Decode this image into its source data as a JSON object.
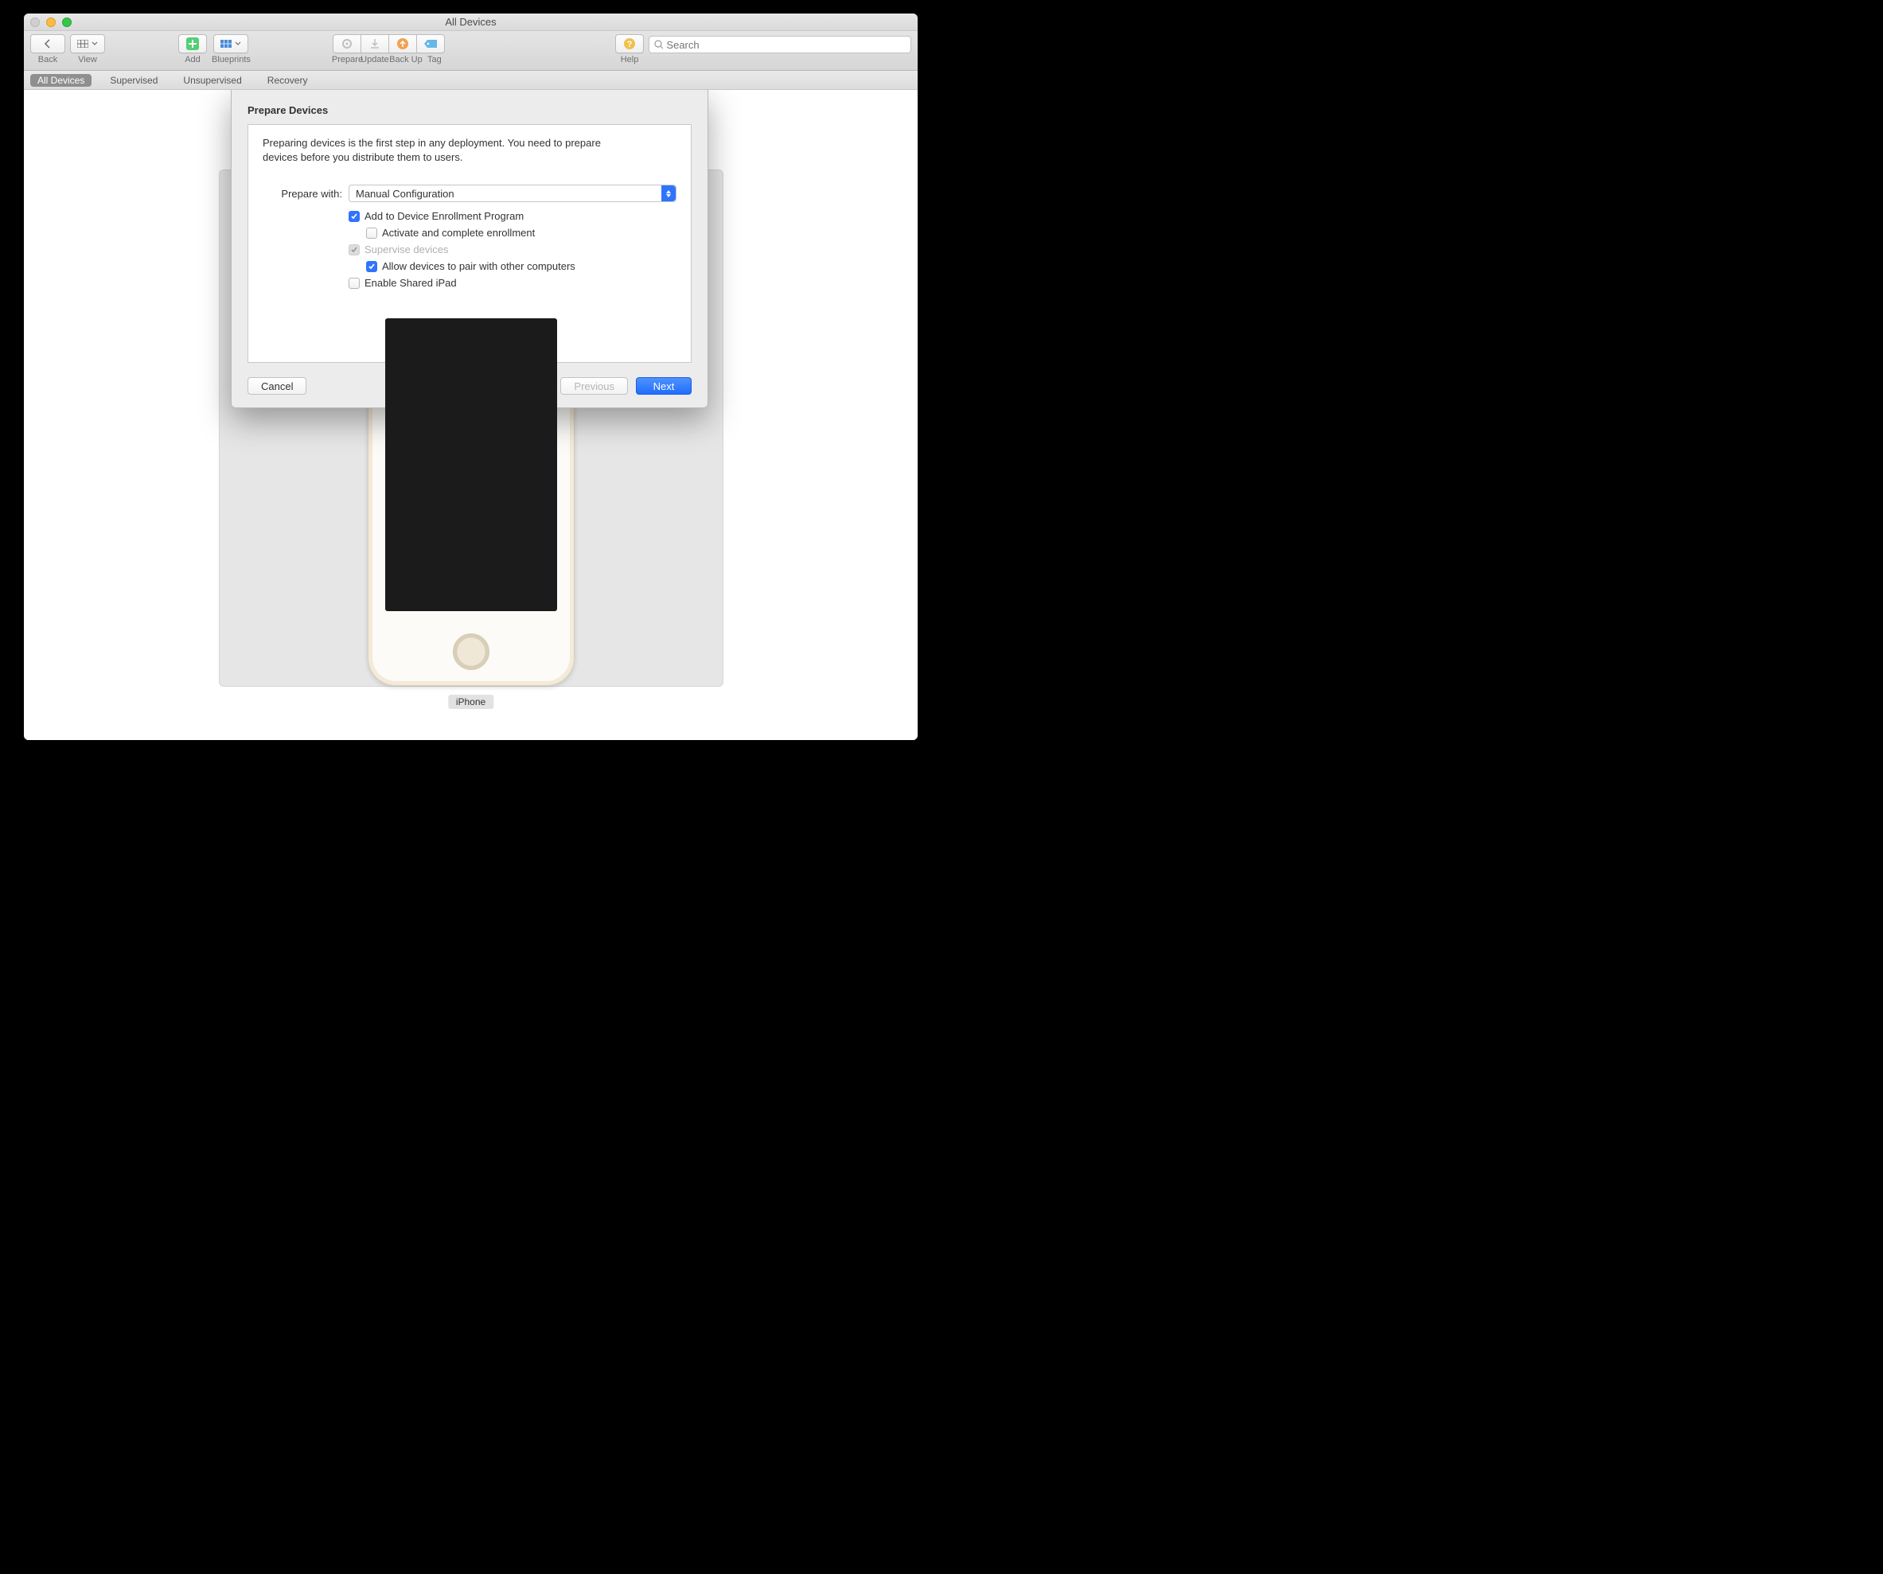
{
  "window": {
    "title": "All Devices"
  },
  "toolbar": {
    "back": "Back",
    "view": "View",
    "add": "Add",
    "blueprints": "Blueprints",
    "prepare": "Prepare",
    "update": "Update",
    "backup": "Back Up",
    "tag": "Tag",
    "help": "Help",
    "search_placeholder": "Search"
  },
  "scope": {
    "items": [
      "All Devices",
      "Supervised",
      "Unsupervised",
      "Recovery"
    ],
    "active_index": 0
  },
  "device": {
    "label": "iPhone"
  },
  "sheet": {
    "title": "Prepare Devices",
    "description": "Preparing devices is the first step in any deployment. You need to prepare devices before you distribute them to users.",
    "prepare_with_label": "Prepare with:",
    "prepare_with_value": "Manual Configuration",
    "checks": {
      "add_dep": {
        "label": "Add to Device Enrollment Program",
        "checked": true,
        "disabled": false,
        "indent": 0
      },
      "activate": {
        "label": "Activate and complete enrollment",
        "checked": false,
        "disabled": false,
        "indent": 1
      },
      "supervise": {
        "label": "Supervise devices",
        "checked": true,
        "disabled": true,
        "indent": 0
      },
      "pair": {
        "label": "Allow devices to pair with other computers",
        "checked": true,
        "disabled": false,
        "indent": 1
      },
      "shared_ipad": {
        "label": "Enable Shared iPad",
        "checked": false,
        "disabled": false,
        "indent": 0
      }
    },
    "cancel": "Cancel",
    "previous": "Previous",
    "next": "Next"
  }
}
